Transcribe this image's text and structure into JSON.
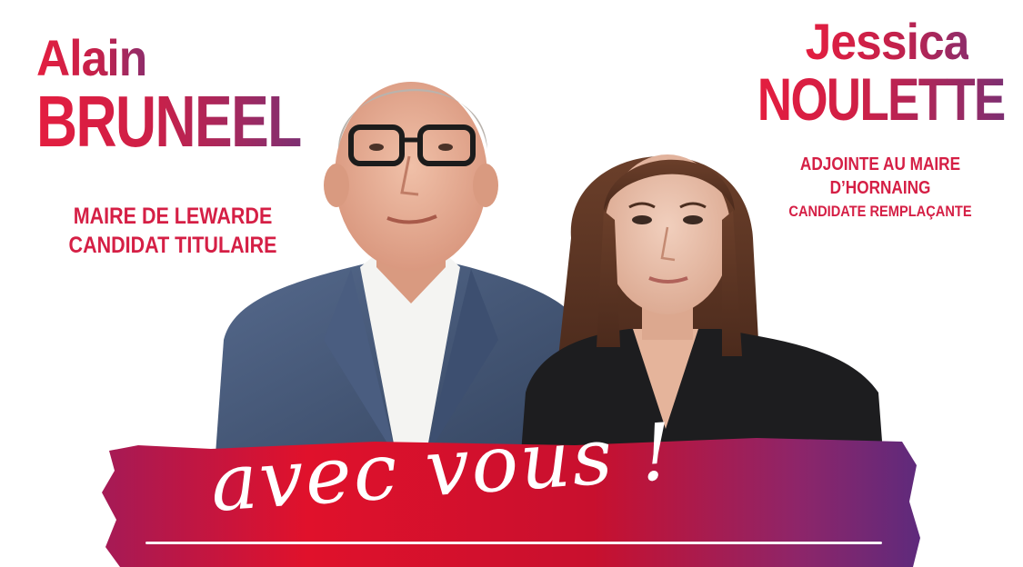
{
  "candidate_titular": {
    "first_name": "Alain",
    "last_name": "BRUNEEL",
    "role_line1": "MAIRE DE LEWARDE",
    "role_line2": "CANDIDAT TITULAIRE"
  },
  "candidate_substitute": {
    "first_name": "Jessica",
    "last_name": "NOULETTE",
    "role_line1": "ADJOINTE AU MAIRE",
    "role_line2": "D’HORNAING",
    "role_line3": "CANDIDATE REMPLAÇANTE"
  },
  "slogan": "avec vous !",
  "colors": {
    "red": "#e41e3f",
    "crimson": "#c8102e",
    "magenta": "#8e2d6b",
    "purple": "#6b2a7a",
    "white": "#ffffff"
  }
}
